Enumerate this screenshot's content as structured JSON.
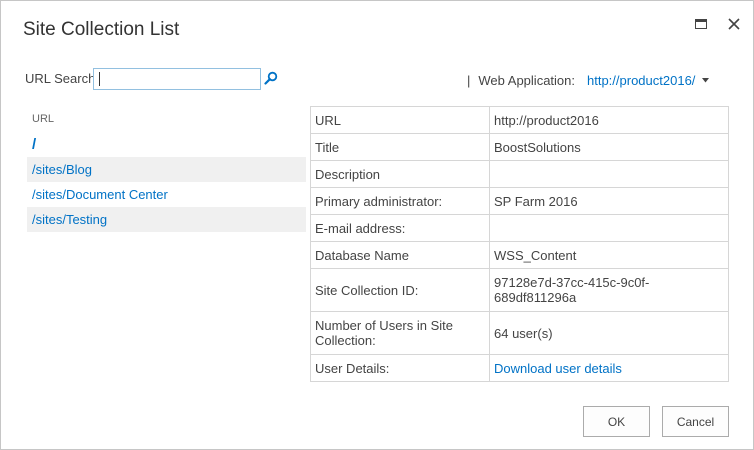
{
  "dialog": {
    "title": "Site Collection List"
  },
  "search": {
    "label": "URL Search",
    "value": "",
    "icon": "search-icon"
  },
  "web_application": {
    "separator": "|",
    "label": "Web Application:",
    "value": "http://product2016/"
  },
  "url_list": {
    "header": "URL",
    "items": [
      {
        "label": "/"
      },
      {
        "label": "/sites/Blog"
      },
      {
        "label": "/sites/Document Center"
      },
      {
        "label": "/sites/Testing"
      }
    ]
  },
  "details": {
    "rows": [
      {
        "key": "URL",
        "value": "http://product2016"
      },
      {
        "key": "Title",
        "value": "BoostSolutions"
      },
      {
        "key": "Description",
        "value": ""
      },
      {
        "key": "Primary administrator:",
        "value": "SP Farm 2016"
      },
      {
        "key": "E-mail address:",
        "value": ""
      },
      {
        "key": "Database Name",
        "value": "WSS_Content"
      },
      {
        "key": "Site Collection ID:",
        "value": "97128e7d-37cc-415c-9c0f-689df811296a"
      },
      {
        "key": "Number of Users in Site Collection:",
        "value": "64 user(s)"
      },
      {
        "key": "User Details:",
        "value": "Download user details"
      }
    ]
  },
  "buttons": {
    "ok": "OK",
    "cancel": "Cancel"
  },
  "colors": {
    "link": "#0072c6",
    "alt_row": "#f0f0f0",
    "input_border": "#92c0e0"
  }
}
